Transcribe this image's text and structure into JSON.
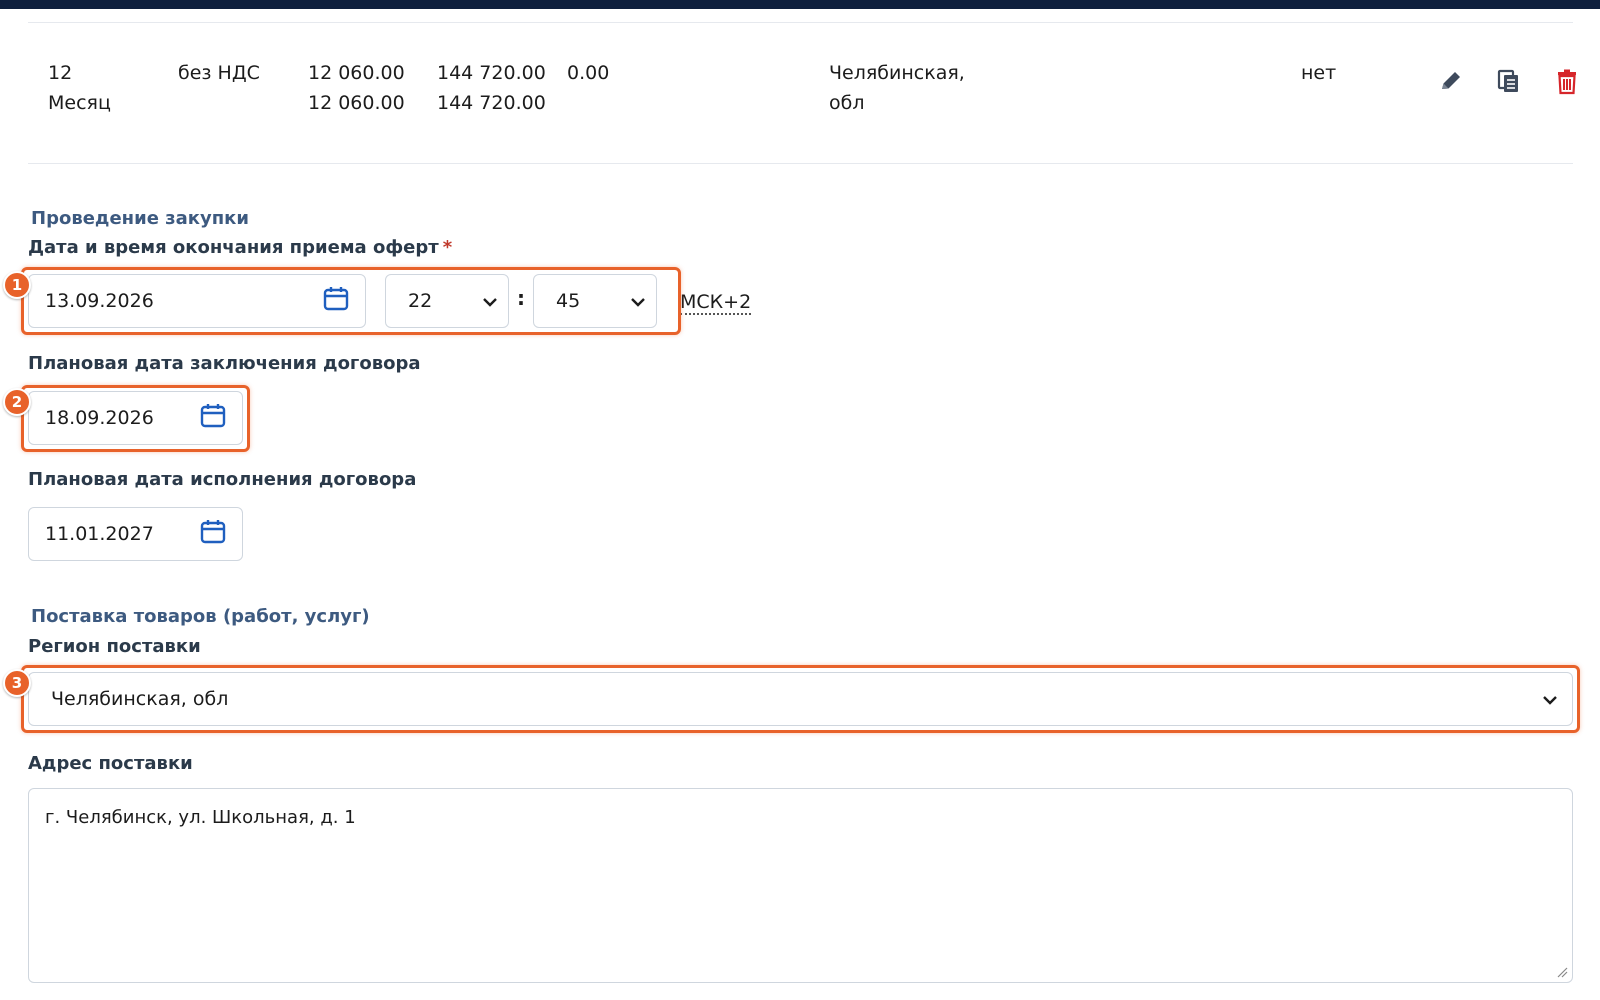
{
  "table_row": {
    "quantity": "12",
    "unit": "Месяц",
    "vat": "без НДС",
    "price_1": "12 060.00",
    "price_2": "12 060.00",
    "total_1": "144 720.00",
    "total_2": "144 720.00",
    "extra": "0.00",
    "region_line1": "Челябинская,",
    "region_line2": "обл",
    "flag": "нет",
    "actions": [
      "pencil-icon",
      "copy-icon",
      "trash-icon"
    ]
  },
  "procurement": {
    "section_title": "Проведение закупки",
    "deadline_label": "Дата и время окончания приема оферт",
    "required_mark": "*",
    "deadline_date": "13.09.2026",
    "deadline_hour": "22",
    "time_separator": ":",
    "deadline_minute": "45",
    "timezone": "МСК+2",
    "contract_date_label": "Плановая дата заключения договора",
    "contract_date": "18.09.2026",
    "execution_date_label": "Плановая дата исполнения договора",
    "execution_date": "11.01.2027"
  },
  "delivery": {
    "section_title": "Поставка товаров (работ, услуг)",
    "region_label": "Регион поставки",
    "region_value": "Челябинская, обл",
    "address_label": "Адрес поставки",
    "address_value": "г. Челябинск, ул. Школьная, д. 1"
  },
  "annotations": [
    "1",
    "2",
    "3"
  ],
  "colors": {
    "accent": "#e8622a",
    "section_title": "#3d5a80",
    "icon_blue": "#1f5fbf",
    "delete_red": "#d6262b",
    "topbar": "#0f1f3d"
  }
}
